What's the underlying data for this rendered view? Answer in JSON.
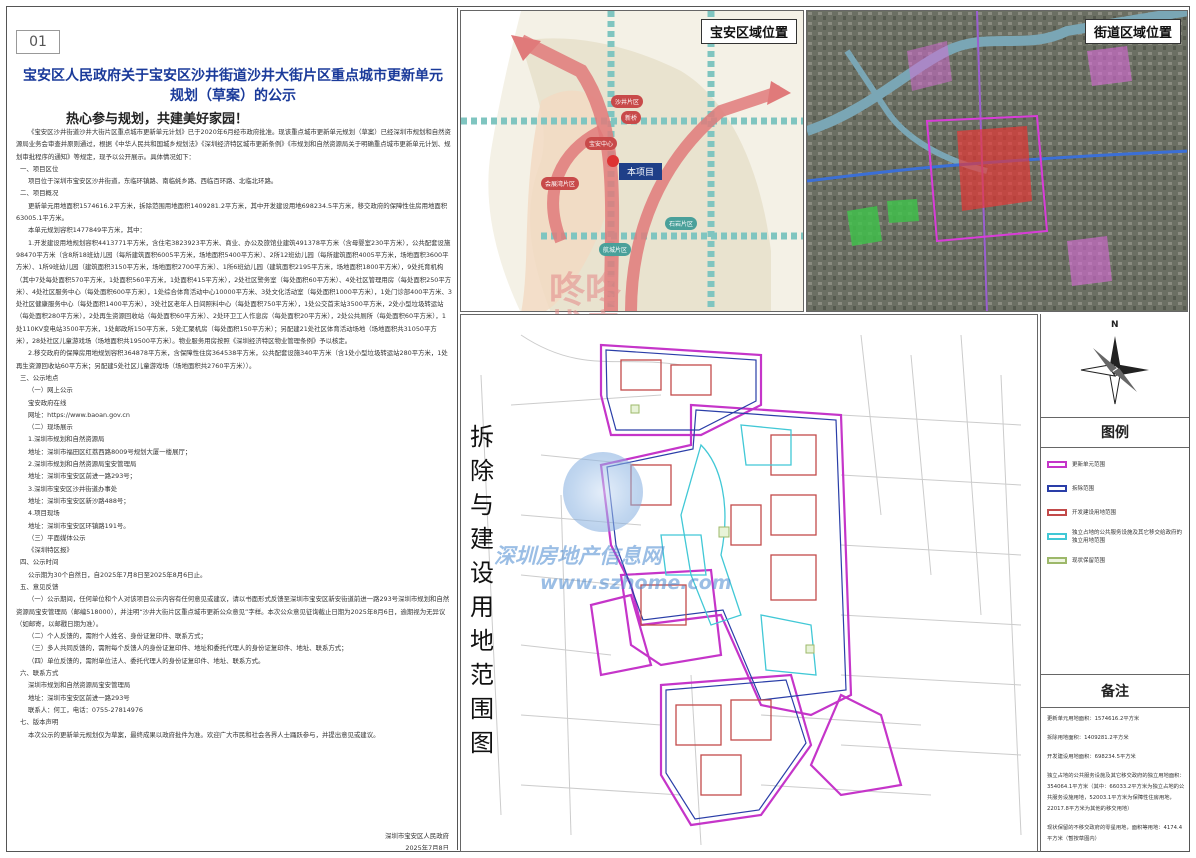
{
  "page_number": "01",
  "notice": {
    "title_line1": "宝安区人民政府关于宝安区沙井街道沙井大街片区重点城市更新单元",
    "title_line2": "规划（草案）的公示",
    "slogan": "热心参与规划，共建美好家园！",
    "paragraphs": [
      "《宝安区沙井街道沙井大街片区重点城市更新单元计划》已于2020年6月经市政府批准。现该重点城市更新单元规划（草案）已经深圳市规划和自然资源局业务会审查并原则通过，根据《中华人民共和国城乡规划法》《深圳经济特区城市更新条例》《市规划和自然资源局关于明确重点城市更新单元计划、规划审批程序的通知》等规定，现予以公开展示。具体情况如下：",
      "一、项目区位",
      "项目位于深圳市宝安区沙井街道，东临环镇路、南临蚝乡路、西临百环路、北临北环路。",
      "二、项目概况",
      "更新单元用地面积1574616.2平方米，拆除范围用地面积1409281.2平方米，其中开发建设用地698234.5平方米，移交政府的保障性住房用地面积63005.1平方米。",
      "本单元规划容积1477849平方米，其中：",
      "1.开发建设用地规划容积4413771平方米，含住宅3823923平方米、商业、办公及旅馆业建筑491378平方米（含母婴室230平方米），公共配套设施98470平方米（含8所18班幼儿园（每所建筑面积6005平方米，场地面积5400平方米）、2所12班幼儿园（每所建筑面积4005平方米，场地面积3600平方米）、1所9班幼儿园（建筑面积3150平方米，场地面积2700平方米）、1所6班幼儿园（建筑面积2195平方米，场地面积1800平方米），9处托育机构（其中7处每处面积570平方米，1处面积560平方米，1处面积415平方米），2处社区警务室（每处面积60平方米）、4处社区管理用房（每处面积250平方米）、4处社区服务中心（每处面积600平方米），1处综合体育活动中心10000平方米、3处文化活动室（每处面积1000平方米），1处门诊部400平方米、3处社区健康服务中心（每处面积1400平方米），3处社区老年人日间照料中心（每处面积750平方米），1处公交首末站3500平方米，2处小型垃圾转运站（每处面积280平方米），2处再生资源回收站（每处面积60平方米）、2处环卫工人作息房（每处面积20平方米），2处公共厕所（每处面积60平方米），1处110KV变电站3500平方米，1处邮政所150平方米，5处汇聚机房（每处面积150平方米）；另配建21处社区体育活动场地（场地面积共31050平方米），28处社区儿童游戏场（场地面积共19500平方米）。物业服务用房按照《深圳经济特区物业管理条例》予以核定。",
      "2.移交政府的保障房用地规划容积364878平方米，含保障性住房364538平方米，公共配套设施340平方米（含1处小型垃圾转运站280平方米，1处再生资源回收站60平方米；另配建5处社区儿童游戏场（场地面积共2760平方米））。",
      "三、公示地点",
      "（一）网上公示",
      "宝安政府在线",
      "网址：https://www.baoan.gov.cn",
      "（二）现场展示",
      "1.深圳市规划和自然资源局",
      "地址：深圳市福田区红荔西路8009号规划大厦一楼展厅；",
      "2.深圳市规划和自然资源局宝安管理局",
      "地址：深圳市宝安区前进一路293号；",
      "3.深圳市宝安区沙井街道办事处",
      "地址：深圳市宝安区新沙路488号；",
      "4.项目现场",
      "地址：深圳市宝安区环镇路191号。",
      "（三）平面媒体公示",
      "《深圳特区报》",
      "四、公示时间",
      "公示期为30个自然日，自2025年7月8日至2025年8月6日止。",
      "五、意见反馈",
      "（一）公示期间，任何单位和个人对该项目公示内容有任何意见或建议，请以书面形式反馈至深圳市宝安区新安街道前进一路293号深圳市规划和自然资源局宝安管理局（邮编518000），并注明“沙井大街片区重点城市更新公众意见”字样。本次公众意见征询截止日期为2025年8月6日，逾期视为无异议（如邮寄，以邮戳日期为准）。",
      "（二）个人反馈的，需附个人姓名、身份证复印件、联系方式；",
      "（三）多人共同反馈的，需附每个反馈人的身份证复印件、地址和委托代理人的身份证复印件、地址、联系方式；",
      "（四）单位反馈的，需附单位法人、委托代理人的身份证复印件、地址、联系方式。",
      "六、联系方式",
      "深圳市规划和自然资源局宝安管理局",
      "地址：深圳市宝安区前进一路293号",
      "联系人：何工，电话：0755-27814976",
      "七、版本声明",
      "本次公示的更新单元规划仅为草案，最终成果以政府批件为准。欢迎广大市民和社会各界人士踊跃参与，并提出意见或建议。"
    ],
    "signature": "深圳市宝安区人民政府",
    "date": "2025年7月8日"
  },
  "map_baoan": {
    "title": "宝安区域位置",
    "project_label": "本项目",
    "labels": [
      "沙井片区",
      "宝安中心",
      "石岩片区",
      "航城片区",
      "会展湾片区",
      "新桥"
    ]
  },
  "map_street": {
    "title": "街道区域位置"
  },
  "main_map": {
    "vertical_title": "拆除与建设用地范围图"
  },
  "watermarks": {
    "logo_text": "咚咚找房",
    "site_name": "深圳房地产信息网",
    "site_url": "www.szhome.com"
  },
  "legend": {
    "north": "N",
    "title": "图例",
    "items": [
      {
        "label": "更新单元范围",
        "color": "#c535c9"
      },
      {
        "label": "拆除范围",
        "color": "#2a3ea8"
      },
      {
        "label": "开发建设用地范围",
        "color": "#c24a4a"
      },
      {
        "label": "独立占地的公共服务设施及其它移交给政府的独立用地范围",
        "color": "#41c8d6"
      },
      {
        "label": "现状保留范围",
        "color": "#9db86a"
      }
    ]
  },
  "notes": {
    "title": "备注",
    "lines": [
      "更新单元用地面积：1574616.2平方米",
      "拆除用地面积：1409281.2平方米",
      "开发建设用地面积：698234.5平方米",
      "独立占地的公共服务设施及其它移交政府的独立用地面积：354064.1平方米（其中：66033.2平方米为独立占地的公共服务设施用地，52003.1平方米为保障性住房用地，22017.8平方米为其他的移交用地）",
      "现状保留的不移交政府的零星用地，面积等用地：4174.4平方米（暂按草图内）"
    ]
  }
}
